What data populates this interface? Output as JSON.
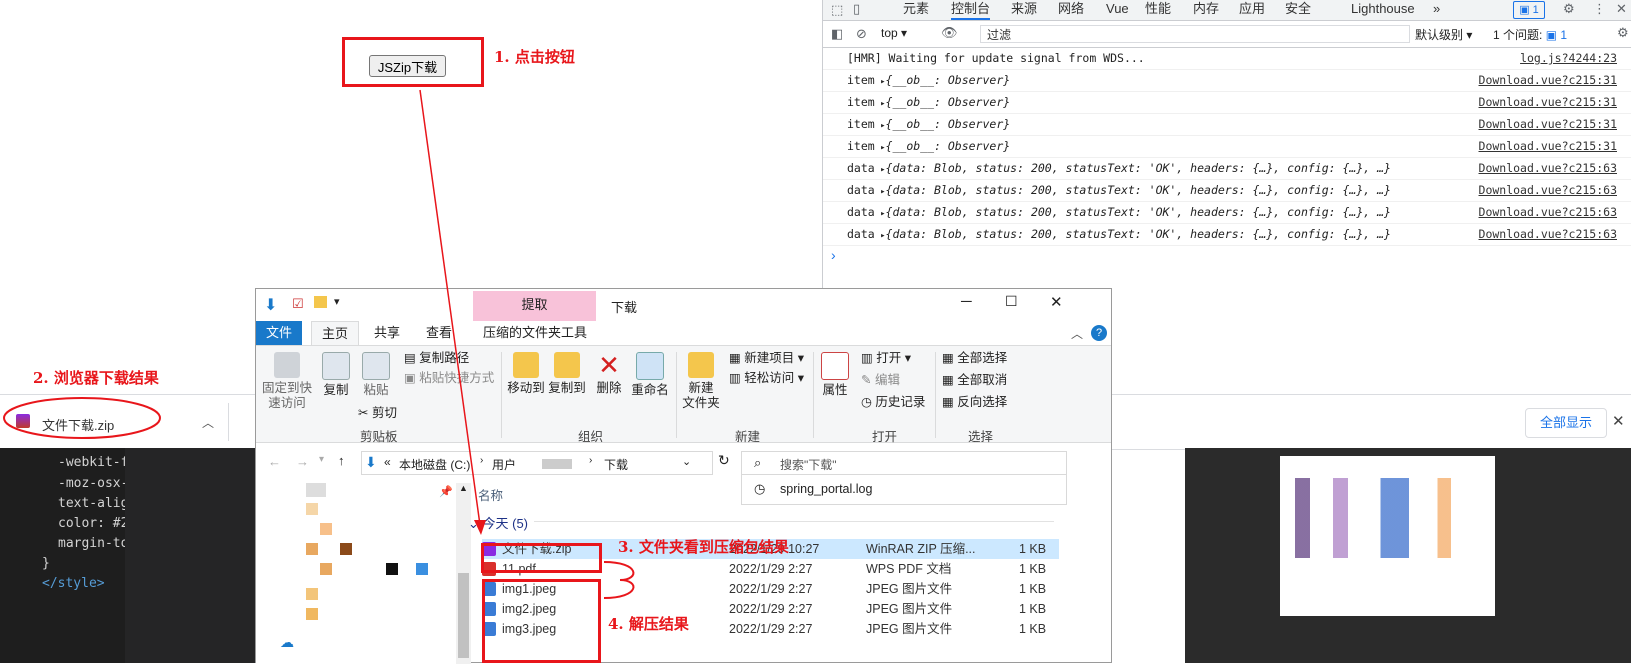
{
  "page": {
    "button_label": "JSZip下载"
  },
  "annotations": {
    "a1": "1. 点击按钮",
    "a2": "2. 浏览器下载结果",
    "a3": "3. 文件夹看到压缩包结果",
    "a4": "4. 解压结果"
  },
  "devtools": {
    "tabs": [
      "元素",
      "控制台",
      "来源",
      "网络",
      "Vue",
      "性能",
      "内存",
      "应用",
      "安全",
      "Lighthouse"
    ],
    "active_tab": "控制台",
    "more": "»",
    "badge": "1",
    "context": "top",
    "filter_placeholder": "过滤",
    "levels": "默认级别",
    "issues": "1 个问题:",
    "issues_count": "1",
    "logs": [
      {
        "label": "",
        "msg": "[HMR] Waiting for update signal from WDS...",
        "src": "log.js?4244:23"
      },
      {
        "label": "item",
        "msg": "{__ob__: Observer}",
        "src": "Download.vue?c215:31"
      },
      {
        "label": "item",
        "msg": "{__ob__: Observer}",
        "src": "Download.vue?c215:31"
      },
      {
        "label": "item",
        "msg": "{__ob__: Observer}",
        "src": "Download.vue?c215:31"
      },
      {
        "label": "item",
        "msg": "{__ob__: Observer}",
        "src": "Download.vue?c215:31"
      },
      {
        "label": "data",
        "msg": "{data: Blob, status: 200, statusText: 'OK', headers: {…}, config: {…}, …}",
        "src": "Download.vue?c215:63"
      },
      {
        "label": "data",
        "msg": "{data: Blob, status: 200, statusText: 'OK', headers: {…}, config: {…}, …}",
        "src": "Download.vue?c215:63"
      },
      {
        "label": "data",
        "msg": "{data: Blob, status: 200, statusText: 'OK', headers: {…}, config: {…}, …}",
        "src": "Download.vue?c215:63"
      },
      {
        "label": "data",
        "msg": "{data: Blob, status: 200, statusText: 'OK', headers: {…}, config: {…}, …}",
        "src": "Download.vue?c215:63"
      }
    ],
    "prompt": "›"
  },
  "downloads": {
    "file_name": "文件下载.zip",
    "show_all": "全部显示",
    "close": "✕"
  },
  "ide": {
    "lines": [
      "-webkit-f",
      "-moz-osx-",
      "text-alig",
      "color: #2",
      "margin-to",
      "}",
      "</style>"
    ]
  },
  "explorer": {
    "title": "下载",
    "context_tab": "提取",
    "tabs": [
      "文件",
      "主页",
      "共享",
      "查看",
      "压缩的文件夹工具"
    ],
    "ribbon": {
      "pin": "固定到快\n速访问",
      "copy": "复制",
      "paste": "粘贴",
      "copy_path": "复制路径",
      "paste_shortcut": "粘贴快捷方式",
      "cut": "剪切",
      "group_clipboard": "剪贴板",
      "move_to": "移动到",
      "copy_to": "复制到",
      "delete": "删除",
      "rename": "重命名",
      "group_organize": "组织",
      "new_folder": "新建\n文件夹",
      "new_item": "新建项目",
      "easy_access": "轻松访问",
      "group_new": "新建",
      "properties": "属性",
      "open": "打开",
      "edit": "编辑",
      "history": "历史记录",
      "group_open": "打开",
      "select_all": "全部选择",
      "select_none": "全部取消",
      "invert": "反向选择",
      "group_select": "选择"
    },
    "address": {
      "prefix": "«",
      "drive": "本地磁盘 (C:)",
      "users": "用户",
      "folder": "下载"
    },
    "search_placeholder": "搜索\"下载\"",
    "suggestion": "spring_portal.log",
    "column_name": "名称",
    "group_label": "今天 (5)",
    "files": [
      {
        "name": "文件下载.zip",
        "date": "2022/1/29 10:27",
        "type": "WinRAR ZIP 压缩...",
        "size": "1 KB",
        "icon": "winrar-icon",
        "color": "#8a2be2"
      },
      {
        "name": "11.pdf",
        "date": "2022/1/29 2:27",
        "type": "WPS PDF 文档",
        "size": "1 KB",
        "icon": "pdf-icon",
        "color": "#d9302c"
      },
      {
        "name": "img1.jpeg",
        "date": "2022/1/29 2:27",
        "type": "JPEG 图片文件",
        "size": "1 KB",
        "icon": "jpeg-icon",
        "color": "#3a7bd5"
      },
      {
        "name": "img2.jpeg",
        "date": "2022/1/29 2:27",
        "type": "JPEG 图片文件",
        "size": "1 KB",
        "icon": "jpeg-icon",
        "color": "#3a7bd5"
      },
      {
        "name": "img3.jpeg",
        "date": "2022/1/29 2:27",
        "type": "JPEG 图片文件",
        "size": "1 KB",
        "icon": "jpeg-icon",
        "color": "#3a7bd5"
      }
    ]
  },
  "colors": {
    "annotation_red": "#e8161b",
    "explorer_file_tab": "#1979ca",
    "context_tab_pink": "#f8c2d9",
    "selection_blue": "#cce8ff",
    "devtools_link": "#1a73e8"
  }
}
